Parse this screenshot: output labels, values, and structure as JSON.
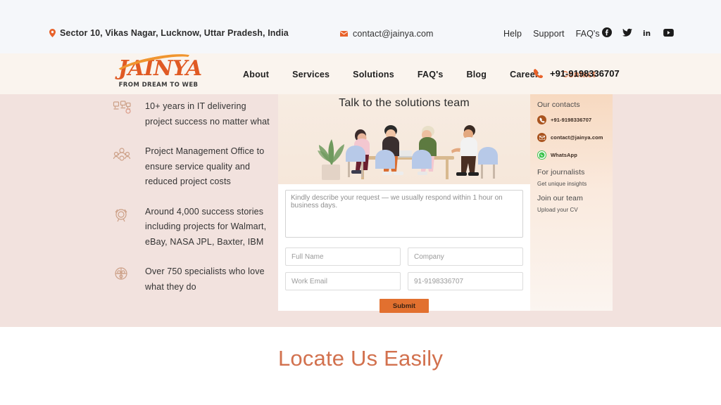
{
  "topbar": {
    "address": "Sector 10, Vikas Nagar, Lucknow, Uttar Pradesh, India",
    "email": "contact@jainya.com",
    "links": [
      {
        "label": "Help"
      },
      {
        "label": "Support"
      },
      {
        "label": "FAQ's"
      }
    ],
    "social": [
      {
        "name": "facebook-icon"
      },
      {
        "name": "twitter-icon"
      },
      {
        "name": "linkedin-icon"
      },
      {
        "name": "youtube-icon"
      }
    ],
    "pin_icon": "location-pin-icon",
    "mail_icon": "envelope-icon"
  },
  "nav": {
    "logo_word": "AINYA",
    "logo_initial": "J",
    "logo_tagline": "FROM DREAM TO WEB",
    "items": [
      {
        "label": "About",
        "active": false
      },
      {
        "label": "Services",
        "active": false
      },
      {
        "label": "Solutions",
        "active": false
      },
      {
        "label": "FAQ's",
        "active": false
      },
      {
        "label": "Blog",
        "active": false
      },
      {
        "label": "Career",
        "active": false
      },
      {
        "label": "Contact",
        "active": true
      }
    ],
    "phone": "+91-9198336707",
    "phone_icon": "phone-icon"
  },
  "features": [
    {
      "icon": "trophy-icon",
      "text": "10+ years in IT delivering project success no matter what"
    },
    {
      "icon": "team-gear-icon",
      "text": "Project Management Office to ensure service quality and reduced project costs"
    },
    {
      "icon": "medal-icon",
      "text": "Around 4,000 success stories including projects for Walmart, eBay, NASA JPL, Baxter, IBM"
    },
    {
      "icon": "people-group-icon",
      "text": "Over 750 specialists who love what they do"
    }
  ],
  "form": {
    "title": "Talk to the solutions team",
    "message_placeholder": "Kindly describe your request — we usually respond within 1 hour on business days.",
    "message_value": "",
    "fields": [
      {
        "name": "full-name",
        "placeholder": "Full Name",
        "value": ""
      },
      {
        "name": "company",
        "placeholder": "Company",
        "value": ""
      },
      {
        "name": "work-email",
        "placeholder": "Work Email",
        "value": ""
      },
      {
        "name": "phone",
        "placeholder": "91-9198336707",
        "value": ""
      }
    ],
    "submit_label": "Submit"
  },
  "side_panel": {
    "contacts_title": "Our contacts",
    "contacts": [
      {
        "icon": "phone-circle-icon",
        "label": "+91-9198336707",
        "color": "#a9541f"
      },
      {
        "icon": "envelope-circle-icon",
        "label": "contact@jainya.com",
        "color": "#a9541f"
      },
      {
        "icon": "whatsapp-icon",
        "label": "WhatsApp",
        "color": "#3ec34f"
      }
    ],
    "journalists_title": "For journalists",
    "journalists_link": "Get unique insights",
    "team_title": "Join our team",
    "team_link": "Upload your CV"
  },
  "locate": {
    "title": "Locate Us Easily"
  },
  "colors": {
    "accent_orange": "#e8622a",
    "nav_active": "#e2855c",
    "band_pink": "#f2e2de",
    "topbar_gray": "#f5f7fa",
    "nav_cream": "#faf4ee",
    "submit_orange": "#e2702f",
    "locate_title": "#d2714e"
  }
}
